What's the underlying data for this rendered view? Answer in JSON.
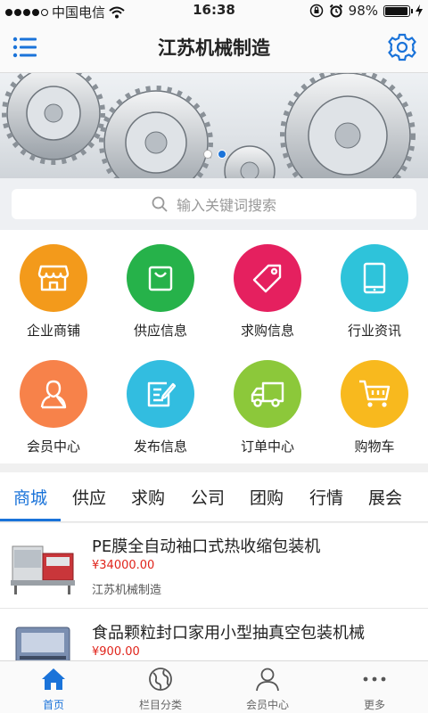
{
  "status_bar": {
    "carrier": "中国电信",
    "time": "16:38",
    "battery": "98%",
    "battery_level": 0.98,
    "signal_bars_filled": 4
  },
  "nav": {
    "title": "江苏机械制造",
    "menu_icon": "menu-icon",
    "settings_icon": "gear-icon"
  },
  "banner": {
    "slide_count": 2,
    "active_slide": 2
  },
  "search": {
    "placeholder": "输入关键词搜索"
  },
  "categories": [
    {
      "label": "企业商铺",
      "icon": "store-icon",
      "color": "#f39a1b"
    },
    {
      "label": "供应信息",
      "icon": "shopping-bag-icon",
      "color": "#26b24a"
    },
    {
      "label": "求购信息",
      "icon": "tag-icon",
      "color": "#e5205f"
    },
    {
      "label": "行业资讯",
      "icon": "tablet-icon",
      "color": "#2ec3da"
    },
    {
      "label": "会员中心",
      "icon": "user-icon",
      "color": "#f7824a"
    },
    {
      "label": "发布信息",
      "icon": "edit-icon",
      "color": "#32bde0"
    },
    {
      "label": "订单中心",
      "icon": "truck-icon",
      "color": "#8cc83a"
    },
    {
      "label": "购物车",
      "icon": "cart-icon",
      "color": "#f8b91e"
    }
  ],
  "tabs": [
    {
      "label": "商城",
      "active": true
    },
    {
      "label": "供应"
    },
    {
      "label": "求购"
    },
    {
      "label": "公司"
    },
    {
      "label": "团购"
    },
    {
      "label": "行情"
    },
    {
      "label": "展会"
    }
  ],
  "products": [
    {
      "name": "PE膜全自动袖口式热收缩包装机",
      "price": "¥34000.00",
      "shop": "江苏机械制造"
    },
    {
      "name": "食品颗粒封口家用小型抽真空包装机械",
      "price": "¥900.00",
      "shop": ""
    }
  ],
  "tabbar": [
    {
      "label": "首页",
      "icon": "home-icon",
      "active": true
    },
    {
      "label": "栏目分类",
      "icon": "globe-icon"
    },
    {
      "label": "会员中心",
      "icon": "user-icon"
    },
    {
      "label": "更多",
      "icon": "more-icon"
    }
  ],
  "colors": {
    "accent": "#1a73d9",
    "price": "#e0241b"
  }
}
